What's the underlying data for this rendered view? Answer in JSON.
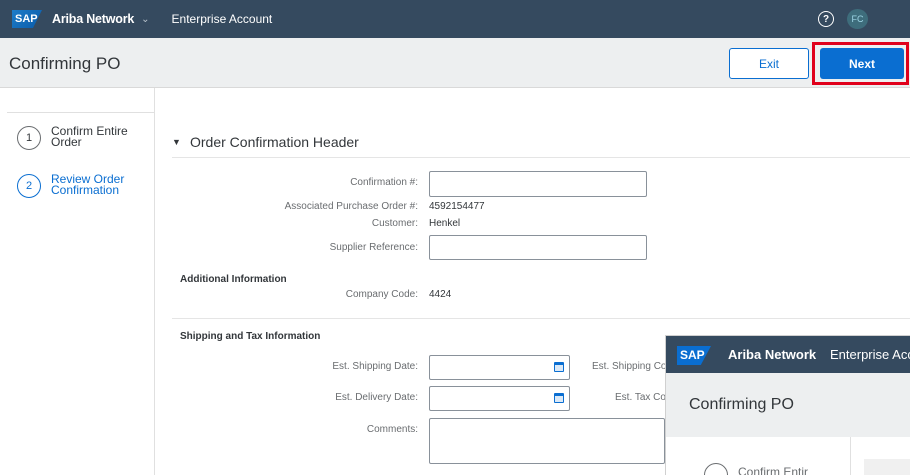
{
  "topbar": {
    "logo_text": "SAP",
    "app_name": "Ariba Network",
    "caret": "⌄",
    "account_type": "Enterprise Account",
    "help_glyph": "?",
    "avatar_initials": "FC"
  },
  "header": {
    "title": "Confirming PO",
    "exit_label": "Exit",
    "next_label": "Next"
  },
  "steps": [
    {
      "number": "1",
      "label": "Confirm Entire Order"
    },
    {
      "number": "2",
      "label": "Review Order Confirmation"
    }
  ],
  "section": {
    "toggle": "▼",
    "title": "Order Confirmation Header"
  },
  "fields": {
    "confirmation_label": "Confirmation #:",
    "confirmation_value": "",
    "po_label": "Associated Purchase Order #:",
    "po_value": "4592154477",
    "customer_label": "Customer:",
    "customer_value": "Henkel",
    "supplier_ref_label": "Supplier Reference:",
    "supplier_ref_value": ""
  },
  "additional": {
    "title": "Additional Information",
    "company_code_label": "Company Code:",
    "company_code_value": "4424"
  },
  "shipping": {
    "title": "Shipping and Tax Information",
    "ship_date_label": "Est. Shipping Date:",
    "delivery_date_label": "Est. Delivery Date:",
    "comments_label": "Comments:",
    "ship_cost_label": "Est. Shipping Co",
    "tax_cost_label": "Est. Tax Co"
  },
  "overlay": {
    "logo_text": "SAP",
    "app_name": "Ariba Network",
    "account_type": "Enterprise Acco",
    "title": "Confirming PO",
    "step_label": "Confirm Entir"
  },
  "colors": {
    "topbar": "#354a5f",
    "accent": "#0a6ed1",
    "highlight": "#e0001b"
  }
}
